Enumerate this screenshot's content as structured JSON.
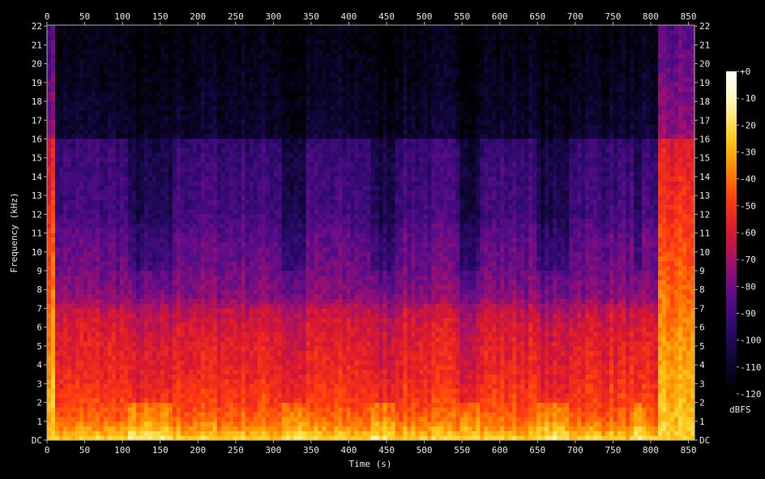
{
  "chart_data": {
    "type": "heatmap",
    "title": "",
    "xlabel": "Time (s)",
    "ylabel": "Frequency (kHz)",
    "xlim": [
      0,
      858
    ],
    "ylim": [
      0,
      22.05
    ],
    "x_ticks": [
      0,
      50,
      100,
      150,
      200,
      250,
      300,
      350,
      400,
      450,
      500,
      550,
      600,
      650,
      700,
      750,
      800,
      850
    ],
    "x_tick_labels": [
      "0",
      "50",
      "100",
      "150",
      "200",
      "250",
      "300",
      "350",
      "400",
      "450",
      "500",
      "550",
      "600",
      "650",
      "700",
      "750",
      "800",
      "850"
    ],
    "y_ticks": [
      0,
      1,
      2,
      3,
      4,
      5,
      6,
      7,
      8,
      9,
      10,
      11,
      12,
      13,
      14,
      15,
      16,
      17,
      18,
      19,
      20,
      21,
      22
    ],
    "y_tick_labels": [
      "DC",
      "1",
      "2",
      "3",
      "4",
      "5",
      "6",
      "7",
      "8",
      "9",
      "10",
      "11",
      "12",
      "13",
      "14",
      "15",
      "16",
      "17",
      "18",
      "19",
      "20",
      "21",
      "22"
    ],
    "colorbar": {
      "label": "dBFS",
      "range": [
        -120,
        0
      ],
      "ticks": [
        0,
        -10,
        -20,
        -30,
        -40,
        -50,
        -60,
        -70,
        -80,
        -90,
        -100,
        -110,
        -120
      ],
      "tick_labels": [
        "+0",
        "-10",
        "-20",
        "-30",
        "-40",
        "-50",
        "-60",
        "-70",
        "-80",
        "-90",
        "-100",
        "-110",
        "-120"
      ]
    },
    "colormap": [
      "#000000",
      "#0c0630",
      "#2a0a6a",
      "#5a0c8a",
      "#9a1070",
      "#d81830",
      "#ff3a10",
      "#ff8a00",
      "#ffd020",
      "#fff6b0",
      "#ffffff"
    ],
    "lowpass_cutoff_khz": 16,
    "energy_profile_db_by_freq_khz": [
      [
        0,
        -22
      ],
      [
        0.5,
        -32
      ],
      [
        1,
        -40
      ],
      [
        2,
        -48
      ],
      [
        3,
        -52
      ],
      [
        4,
        -55
      ],
      [
        5,
        -57
      ],
      [
        6,
        -60
      ],
      [
        7,
        -64
      ],
      [
        7.5,
        -74
      ],
      [
        9,
        -80
      ],
      [
        11,
        -84
      ],
      [
        12,
        -90
      ],
      [
        15,
        -92
      ],
      [
        16,
        -94
      ],
      [
        16.1,
        -108
      ],
      [
        22,
        -116
      ]
    ],
    "quiet_gaps_s": [
      [
        105,
        165
      ],
      [
        310,
        345
      ],
      [
        430,
        460
      ],
      [
        545,
        575
      ],
      [
        650,
        690
      ],
      [
        775,
        790
      ]
    ],
    "full_band_segments_s": [
      [
        0,
        12
      ],
      [
        812,
        858
      ]
    ]
  }
}
